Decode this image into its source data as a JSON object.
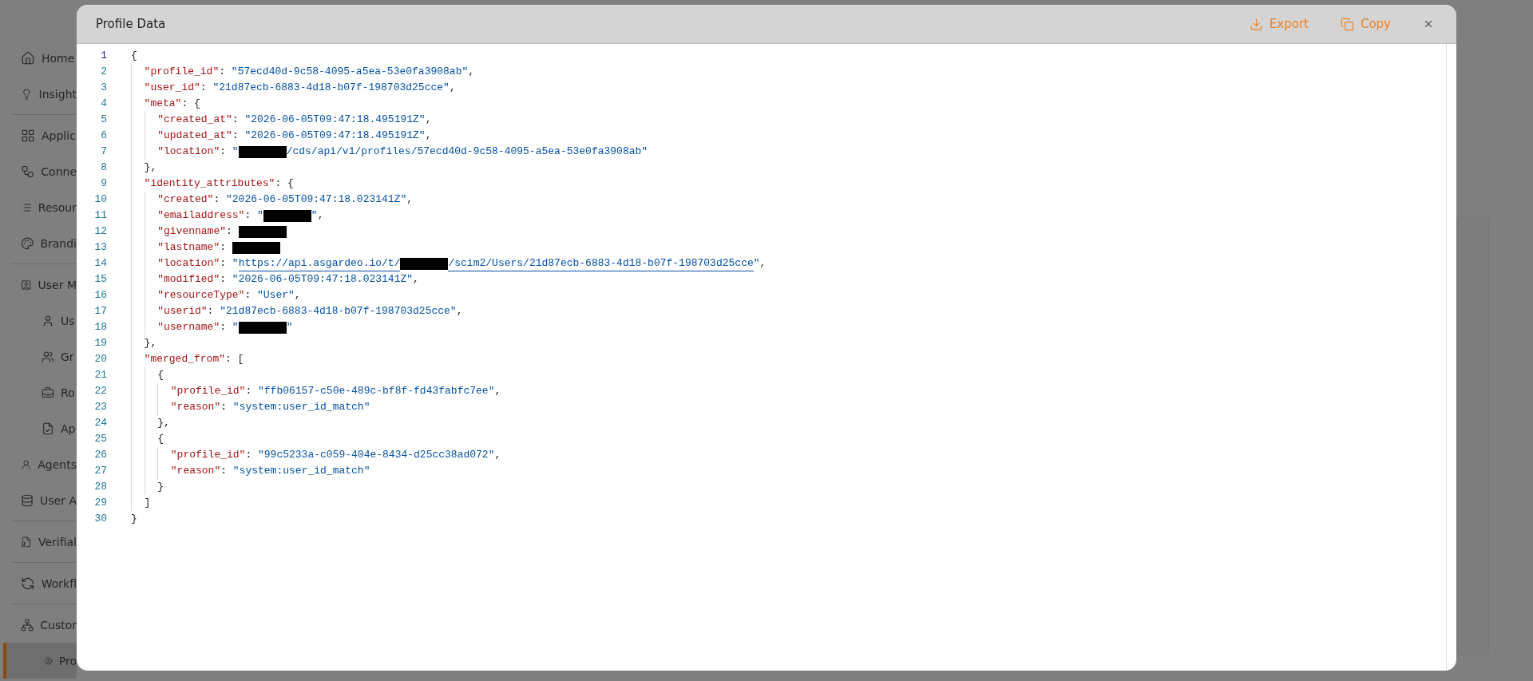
{
  "sidebar": {
    "groups": [
      [
        {
          "label": "Home",
          "selected": false
        },
        {
          "label": "Insight",
          "selected": false
        }
      ],
      [
        {
          "label": "Applic",
          "selected": false
        },
        {
          "label": "Conne",
          "selected": false
        },
        {
          "label": "Resour",
          "selected": false
        },
        {
          "label": "Brandi",
          "selected": false
        }
      ],
      [
        {
          "label": "User M",
          "selected": false,
          "children": [
            {
              "label": "Us",
              "selected": false
            },
            {
              "label": "Gr",
              "selected": false
            },
            {
              "label": "Ro",
              "selected": false
            },
            {
              "label": "Ap",
              "selected": false
            }
          ]
        },
        {
          "label": "Agents",
          "selected": false
        },
        {
          "label": "User A",
          "selected": false
        }
      ],
      [
        {
          "label": "Verifial",
          "selected": false
        }
      ],
      [
        {
          "label": "Workfl",
          "selected": false
        }
      ],
      [
        {
          "label": "Custor",
          "selected": false,
          "children": [
            {
              "label": "Pro",
              "selected": true
            }
          ]
        }
      ]
    ]
  },
  "dialog": {
    "title": "Profile Data",
    "actions": [
      {
        "kind": "export",
        "label": "Export"
      },
      {
        "kind": "copy",
        "label": "Copy"
      }
    ],
    "code_lines": [
      [
        {
          "kind": "punct",
          "text": "{"
        }
      ],
      [
        {
          "kind": "key",
          "text": "\"profile_id\""
        },
        {
          "kind": "punct",
          "text": ": "
        },
        {
          "kind": "string",
          "text": "\"57ecd40d-9c58-4095-a5ea-53e0fa3908ab\""
        },
        {
          "kind": "punct",
          "text": ","
        }
      ],
      [
        {
          "kind": "key",
          "text": "\"user_id\""
        },
        {
          "kind": "punct",
          "text": ": "
        },
        {
          "kind": "string",
          "text": "\"21d87ecb-6883-4d18-b07f-198703d25cce\""
        },
        {
          "kind": "punct",
          "text": ","
        }
      ],
      [
        {
          "kind": "key",
          "text": "\"meta\""
        },
        {
          "kind": "punct",
          "text": ": {"
        }
      ],
      [
        {
          "kind": "key",
          "text": "\"created_at\""
        },
        {
          "kind": "punct",
          "text": ": "
        },
        {
          "kind": "string",
          "text": "\"2026-06-05T09:47:18.495191Z\""
        },
        {
          "kind": "punct",
          "text": ","
        }
      ],
      [
        {
          "kind": "key",
          "text": "\"updated_at\""
        },
        {
          "kind": "punct",
          "text": ": "
        },
        {
          "kind": "string",
          "text": "\"2026-06-05T09:47:18.495191Z\""
        },
        {
          "kind": "punct",
          "text": ","
        }
      ],
      [
        {
          "kind": "key",
          "text": "\"location\""
        },
        {
          "kind": "punct",
          "text": ": "
        },
        {
          "kind": "string",
          "text": "\""
        },
        {
          "kind": "redacted"
        },
        {
          "kind": "string",
          "text": "/cds/api/v1/profiles/57ecd40d-9c58-4095-a5ea-53e0fa3908ab\""
        }
      ],
      [
        {
          "kind": "punct",
          "text": "},"
        }
      ],
      [
        {
          "kind": "key",
          "text": "\"identity_attributes\""
        },
        {
          "kind": "punct",
          "text": ": {"
        }
      ],
      [
        {
          "kind": "key",
          "text": "\"created\""
        },
        {
          "kind": "punct",
          "text": ": "
        },
        {
          "kind": "string",
          "text": "\"2026-06-05T09:47:18.023141Z\""
        },
        {
          "kind": "punct",
          "text": ","
        }
      ],
      [
        {
          "kind": "key",
          "text": "\"emailaddress\""
        },
        {
          "kind": "punct",
          "text": ": "
        },
        {
          "kind": "string",
          "text": "\""
        },
        {
          "kind": "redacted"
        },
        {
          "kind": "string",
          "text": "\""
        },
        {
          "kind": "punct",
          "text": ","
        }
      ],
      [
        {
          "kind": "key",
          "text": "\"givenname\""
        },
        {
          "kind": "punct",
          "text": ": "
        },
        {
          "kind": "redacted"
        }
      ],
      [
        {
          "kind": "key",
          "text": "\"lastname\""
        },
        {
          "kind": "punct",
          "text": ": "
        },
        {
          "kind": "redacted"
        }
      ],
      [
        {
          "kind": "key",
          "text": "\"location\""
        },
        {
          "kind": "punct",
          "text": ": "
        },
        {
          "kind": "string",
          "text": "\""
        },
        {
          "kind": "link",
          "text": "https://api.asgardeo.io/t/"
        },
        {
          "kind": "redacted"
        },
        {
          "kind": "link",
          "text": "/scim2/Users/21d87ecb-6883-4d18-b07f-198703d25cce"
        },
        {
          "kind": "string",
          "text": "\""
        },
        {
          "kind": "punct",
          "text": ","
        }
      ],
      [
        {
          "kind": "key",
          "text": "\"modified\""
        },
        {
          "kind": "punct",
          "text": ": "
        },
        {
          "kind": "string",
          "text": "\"2026-06-05T09:47:18.023141Z\""
        },
        {
          "kind": "punct",
          "text": ","
        }
      ],
      [
        {
          "kind": "key",
          "text": "\"resourceType\""
        },
        {
          "kind": "punct",
          "text": ": "
        },
        {
          "kind": "string",
          "text": "\"User\""
        },
        {
          "kind": "punct",
          "text": ","
        }
      ],
      [
        {
          "kind": "key",
          "text": "\"userid\""
        },
        {
          "kind": "punct",
          "text": ": "
        },
        {
          "kind": "string",
          "text": "\"21d87ecb-6883-4d18-b07f-198703d25cce\""
        },
        {
          "kind": "punct",
          "text": ","
        }
      ],
      [
        {
          "kind": "key",
          "text": "\"username\""
        },
        {
          "kind": "punct",
          "text": ": "
        },
        {
          "kind": "string",
          "text": "\""
        },
        {
          "kind": "redacted"
        },
        {
          "kind": "string",
          "text": "\""
        }
      ],
      [
        {
          "kind": "punct",
          "text": "},"
        }
      ],
      [
        {
          "kind": "key",
          "text": "\"merged_from\""
        },
        {
          "kind": "punct",
          "text": ": ["
        }
      ],
      [
        {
          "kind": "punct",
          "text": "{"
        }
      ],
      [
        {
          "kind": "key",
          "text": "\"profile_id\""
        },
        {
          "kind": "punct",
          "text": ": "
        },
        {
          "kind": "string",
          "text": "\"ffb06157-c50e-489c-bf8f-fd43fabfc7ee\""
        },
        {
          "kind": "punct",
          "text": ","
        }
      ],
      [
        {
          "kind": "key",
          "text": "\"reason\""
        },
        {
          "kind": "punct",
          "text": ": "
        },
        {
          "kind": "string",
          "text": "\"system:user_id_match\""
        }
      ],
      [
        {
          "kind": "punct",
          "text": "},"
        }
      ],
      [
        {
          "kind": "punct",
          "text": "{"
        }
      ],
      [
        {
          "kind": "key",
          "text": "\"profile_id\""
        },
        {
          "kind": "punct",
          "text": ": "
        },
        {
          "kind": "string",
          "text": "\"99c5233a-c059-404e-8434-d25cc38ad072\""
        },
        {
          "kind": "punct",
          "text": ","
        }
      ],
      [
        {
          "kind": "key",
          "text": "\"reason\""
        },
        {
          "kind": "punct",
          "text": ": "
        },
        {
          "kind": "string",
          "text": "\"system:user_id_match\""
        }
      ],
      [
        {
          "kind": "punct",
          "text": "}"
        }
      ],
      [
        {
          "kind": "punct",
          "text": "]"
        }
      ],
      [
        {
          "kind": "punct",
          "text": "}"
        }
      ]
    ],
    "line_numbers": [
      "1",
      "2",
      "3",
      "4",
      "5",
      "6",
      "7",
      "8",
      "9",
      "10",
      "11",
      "12",
      "13",
      "14",
      "15",
      "16",
      "17",
      "18",
      "19",
      "20",
      "21",
      "22",
      "23",
      "24",
      "25",
      "26",
      "27",
      "28",
      "29",
      "30"
    ]
  }
}
